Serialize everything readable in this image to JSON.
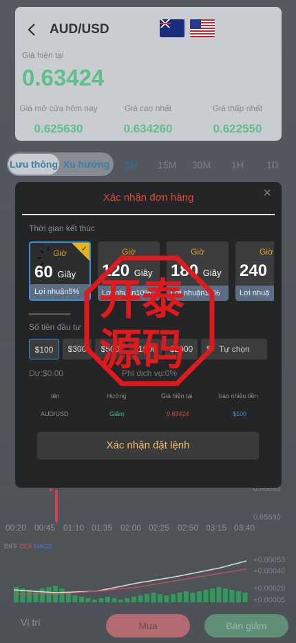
{
  "header": {
    "pair": "AUD/USD",
    "flag_left": "australia-flag",
    "flag_right": "usa-flag"
  },
  "quote": {
    "current_label": "Giá hiện tại",
    "current_value": "0.63424",
    "open_label": "Giá mở cửa hôm nay",
    "open_value": "0.625630",
    "high_label": "Giá cao nhất",
    "high_value": "0.634260",
    "low_label": "Giá thấp nhất",
    "low_value": "0.622550"
  },
  "tabs": {
    "mode_active": "Lưu thông",
    "mode_other": "Xu hướng",
    "timeframes": [
      "5M",
      "15M",
      "30M",
      "1H",
      "1D"
    ]
  },
  "chart": {
    "x_ticks": [
      "00:20",
      "00:45",
      "01:10",
      "01:35",
      "02:00",
      "02:25",
      "02:50",
      "03:15",
      "03:40"
    ],
    "y_ticks_main": [
      "0.65680",
      "0.65680"
    ],
    "y_ticks_macd": [
      "+0.00053",
      "+0.00040",
      "+0.00020",
      "+0.00005"
    ],
    "macd_labels": [
      "DIFF",
      "DEA",
      "MACD"
    ],
    "colors": {
      "diff": "#dddddd",
      "dea": "#d84a5a",
      "macd": "#4a7ad8",
      "histogram": "#2f9a5c",
      "candle_up": "#2f9a5c",
      "candle_down": "#c8444f"
    }
  },
  "modal": {
    "title": "Xác nhận đơn hàng",
    "close_icon": "close-icon",
    "time_label": "Thời gian kết thúc",
    "time_options": [
      {
        "unit": "Giờ",
        "number": "60",
        "suffix": "Giây",
        "profit": "Lợi nhuận5%",
        "selected": true
      },
      {
        "unit": "Giờ",
        "number": "120",
        "suffix": "Giây",
        "profit": "Lợi nhuận10%",
        "selected": false
      },
      {
        "unit": "Giờ",
        "number": "180",
        "suffix": "Giây",
        "profit": "Lợi nhuận15%",
        "selected": false
      },
      {
        "unit": "Giờ",
        "number": "240",
        "suffix": "",
        "profit": "Lợi nhuậ",
        "selected": false
      }
    ],
    "amount_label": "Số tiền đầu tư",
    "amount_options": [
      "$100",
      "$300",
      "$500",
      "$1000",
      "$2000"
    ],
    "amount_selected": "$100",
    "custom_currency": "$",
    "custom_placeholder": "Tự chọn",
    "balance": "Dư:$0.00",
    "fee": "Phí dịch vụ:0%",
    "table": {
      "headers": [
        "tên",
        "Hướng",
        "Giá hiện tại",
        "bao nhiêu tiền"
      ],
      "row": [
        "AUD/USD",
        "Giảm",
        "0.63424",
        "$100"
      ],
      "row_colors": [
        "#8b8d90",
        "#3fc07a",
        "#e2453a",
        "#3c8fd8"
      ]
    },
    "confirm_button": "Xác nhận đặt lệnh"
  },
  "bottom": {
    "position": "Vị trí",
    "buy": "Mua",
    "sell": "Bán giảm"
  },
  "watermark": {
    "text": "开泰源码",
    "color": "#e0191d"
  }
}
